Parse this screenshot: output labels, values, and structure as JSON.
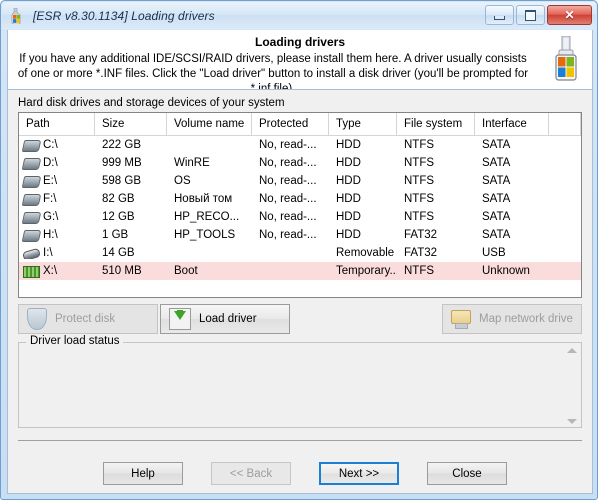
{
  "window": {
    "title": "[ESR v8.30.1134]  Loading drivers",
    "app_icon": "windows-flag-icon",
    "controls": {
      "minimize": "minimize-icon",
      "maximize": "maximize-icon",
      "close": "✕"
    }
  },
  "intro": {
    "title": "Loading drivers",
    "line1": "If you have any additional IDE/SCSI/RAID drivers, please install them here. A driver usually consists of one or",
    "line2": "more *.INF files. Click the \"Load driver\" button to install a disk driver (you'll be prompted for *.inf file).",
    "icon": "usb-drive-icon"
  },
  "drives": {
    "group_label": "Hard disk drives and storage devices of your system",
    "columns": [
      "Path",
      "Size",
      "Volume name",
      "Protected",
      "Type",
      "File system",
      "Interface",
      ""
    ],
    "rows": [
      {
        "icon": "hdd-icon",
        "path": "C:\\",
        "size": "222 GB",
        "volume": "",
        "protected": "No, read-...",
        "type": "HDD",
        "fs": "NTFS",
        "interface": "SATA",
        "selected": false
      },
      {
        "icon": "hdd-icon",
        "path": "D:\\",
        "size": "999 MB",
        "volume": "WinRE",
        "protected": "No, read-...",
        "type": "HDD",
        "fs": "NTFS",
        "interface": "SATA",
        "selected": false
      },
      {
        "icon": "hdd-icon",
        "path": "E:\\",
        "size": "598 GB",
        "volume": "OS",
        "protected": "No, read-...",
        "type": "HDD",
        "fs": "NTFS",
        "interface": "SATA",
        "selected": false
      },
      {
        "icon": "hdd-icon",
        "path": "F:\\",
        "size": "82 GB",
        "volume": "Новый том",
        "protected": "No, read-...",
        "type": "HDD",
        "fs": "NTFS",
        "interface": "SATA",
        "selected": false
      },
      {
        "icon": "hdd-icon",
        "path": "G:\\",
        "size": "12 GB",
        "volume": "HP_RECO...",
        "protected": "No, read-...",
        "type": "HDD",
        "fs": "NTFS",
        "interface": "SATA",
        "selected": false
      },
      {
        "icon": "hdd-icon",
        "path": "H:\\",
        "size": "1 GB",
        "volume": "HP_TOOLS",
        "protected": "No, read-...",
        "type": "HDD",
        "fs": "FAT32",
        "interface": "SATA",
        "selected": false
      },
      {
        "icon": "usb-icon",
        "path": "I:\\",
        "size": "14 GB",
        "volume": "",
        "protected": "",
        "type": "Removable",
        "fs": "FAT32",
        "interface": "USB",
        "selected": false
      },
      {
        "icon": "ram-icon",
        "path": "X:\\",
        "size": "510 MB",
        "volume": "Boot",
        "protected": "",
        "type": "Temporary...",
        "fs": "NTFS",
        "interface": "Unknown",
        "selected": true
      }
    ]
  },
  "actions": {
    "protect_disk": {
      "label": "Protect disk",
      "icon": "shield-icon",
      "enabled": false
    },
    "load_driver": {
      "label": "Load driver",
      "icon": "download-arrow-icon",
      "enabled": true
    },
    "map_network_drive": {
      "label": "Map network drive",
      "icon": "network-drive-icon",
      "enabled": false
    }
  },
  "status": {
    "legend": "Driver load status",
    "text": "",
    "scroll_up": "chevron-up-icon",
    "scroll_down": "chevron-down-icon"
  },
  "footer": {
    "help": "Help",
    "back": "<< Back",
    "next": "Next >>",
    "close": "Close"
  },
  "colors": {
    "selected_row": "#fadcdc",
    "focus_border": "#1b7fd4",
    "frame": "#cfe2f5"
  }
}
